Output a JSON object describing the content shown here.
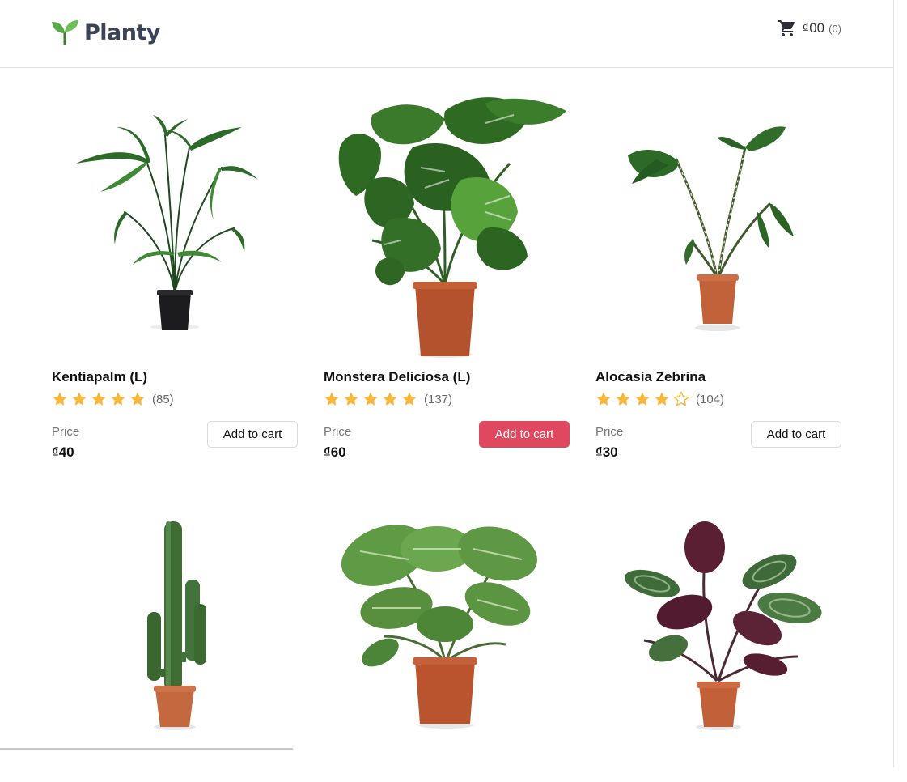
{
  "brand": {
    "name": "Planty",
    "icon": "sprout-icon",
    "icon_color": "#5aa84a"
  },
  "cart": {
    "icon": "cart-icon",
    "total": "₫00",
    "count": "(0)"
  },
  "accent_color": "#e0485f",
  "star_color": "#f6b73c",
  "products": [
    {
      "name": "Kentiapalm (L)",
      "rating": 5,
      "reviews": "(85)",
      "price_label": "Price",
      "price": "₫40",
      "button": "Add to cart"
    },
    {
      "name": "Monstera Deliciosa (L)",
      "rating": 5,
      "reviews": "(137)",
      "price_label": "Price",
      "price": "₫60",
      "button": "Add to cart"
    },
    {
      "name": "Alocasia Zebrina",
      "rating": 4,
      "reviews": "(104)",
      "price_label": "Price",
      "price": "₫30",
      "button": "Add to cart"
    },
    {
      "name": "",
      "image": "cactus"
    },
    {
      "name": "",
      "image": "calathea-orbifolia"
    },
    {
      "name": "",
      "image": "calathea-medallion"
    }
  ]
}
